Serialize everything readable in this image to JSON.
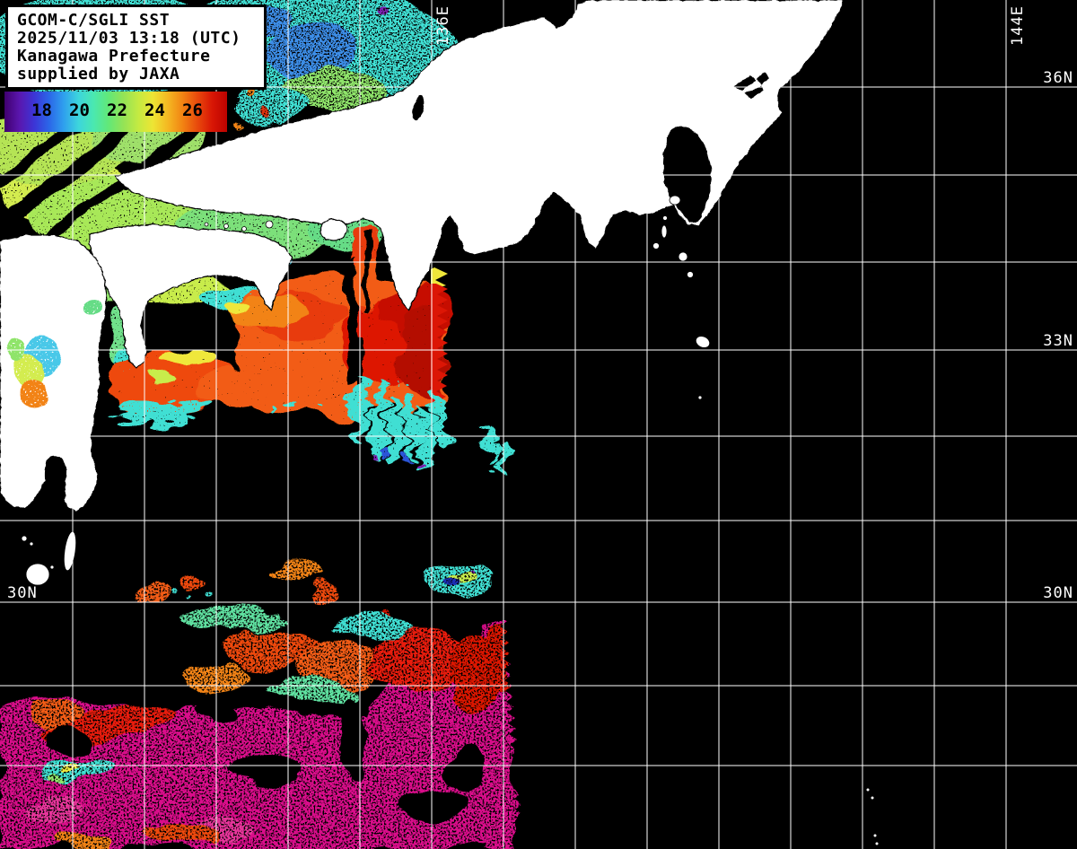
{
  "title_box": {
    "lines": [
      "GCOM-C/SGLI SST",
      "2025/11/03 13:18 (UTC)",
      "Kanagawa Prefecture",
      "supplied by JAXA"
    ]
  },
  "colorbar": {
    "ticks": [
      "18",
      "20",
      "22",
      "24",
      "26"
    ],
    "colors": [
      "#40006E",
      "#5A16AE",
      "#3C35D6",
      "#2B66E8",
      "#2FA0EE",
      "#3DD6DC",
      "#4AE8B0",
      "#62E878",
      "#93E356",
      "#C3EA42",
      "#EDE534",
      "#F4B822",
      "#F28413",
      "#E84A0C",
      "#D81605",
      "#BC0300"
    ]
  },
  "geo_labels": {
    "lon": [
      "136E",
      "144E"
    ],
    "lat_right": [
      "36N",
      "33N",
      "30N"
    ],
    "lat_left": [
      "30N"
    ]
  },
  "palette": {
    "background": "#000000",
    "land": "#ffffff",
    "coastline": "#000000",
    "grid_line": "#ffffff",
    "sea_cold_cyan": "#41DFD3",
    "sea_blue": "#3E8EE8",
    "sea_green": "#8FE46A",
    "sea_yellow_green": "#C8EC4C",
    "warm_orange": "#F25B14",
    "warm_red": "#DC1605",
    "warm_dark_red": "#B40800",
    "hot_magenta": "#D9108A",
    "fringe_purple": "#7B22B0"
  }
}
